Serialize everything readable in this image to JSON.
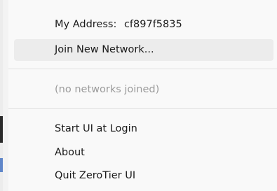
{
  "menu": {
    "address_label": "My Address:",
    "address_value": "cf897f5835",
    "join_network": "Join New Network...",
    "no_networks": "(no networks joined)",
    "start_ui": "Start UI at Login",
    "about": "About",
    "quit": "Quit ZeroTier UI"
  },
  "colors": {
    "menu_bg": "#f9f9f9",
    "hover_bg": "#ececec",
    "text": "#1a1a1a",
    "disabled_text": "#9b9b9b",
    "separator": "#e0e0e0"
  }
}
